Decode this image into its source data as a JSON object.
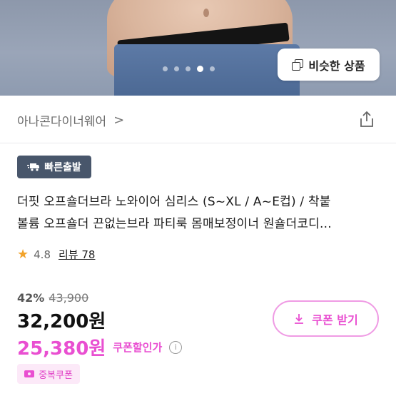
{
  "hero": {
    "dots_total": 5,
    "dots_active_index": 3,
    "similar_button_label": "비슷한 상품"
  },
  "brand": {
    "name": "아나콘다이너웨어",
    "chevron": ">"
  },
  "badge": {
    "label": "빠른출발"
  },
  "product": {
    "title_line1": " 더핏 오프숄더브라 노와이어 심리스 (S~XL / A~E컵) / 착붙",
    "title_line2": "볼륨 오프숄더 끈없는브라 파티룩 몸매보정이너 원숄더코디...",
    "rating": "4.8",
    "review_label": "리뷰 78"
  },
  "price": {
    "discount_percent": "42%",
    "original_price": "43,900",
    "sale_price": "32,200원",
    "coupon_price": "25,380원",
    "coupon_note": "쿠폰할인가",
    "info_icon": "i"
  },
  "coupon_button": {
    "label": "쿠폰 받기"
  },
  "duplicate_coupon": {
    "label": "중복쿠폰"
  },
  "colors": {
    "accent_pink": "#e94fd1",
    "badge_bg": "#48566b",
    "star": "#f2a32b"
  }
}
